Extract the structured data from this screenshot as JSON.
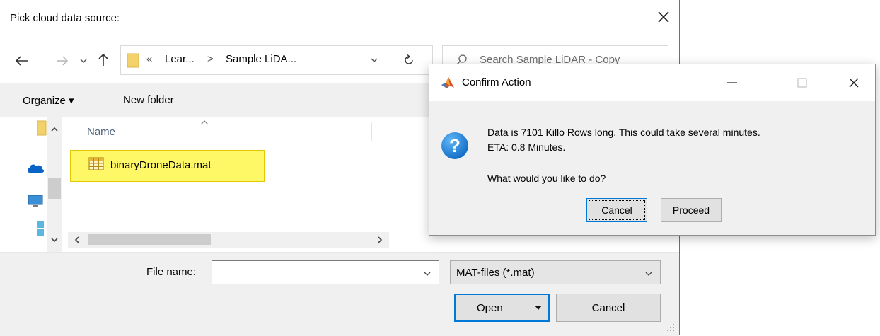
{
  "file_dialog": {
    "title": "Pick cloud data source:",
    "address": {
      "chevron_prefix": "«",
      "crumb1": "Lear...",
      "crumb_sep": ">",
      "crumb2": "Sample LiDA..."
    },
    "search": {
      "placeholder": "Search Sample LiDAR - Copy"
    },
    "toolbar": {
      "organize": "Organize ▾",
      "new_folder": "New folder"
    },
    "columns": {
      "name": "Name"
    },
    "files": [
      {
        "name": "binaryDroneData.mat",
        "icon": "table-file-icon"
      }
    ],
    "filename_label": "File name:",
    "filename_value": "",
    "filter_value": "MAT-files (*.mat)",
    "open_label": "Open",
    "cancel_label": "Cancel"
  },
  "confirm_dialog": {
    "title": "Confirm Action",
    "message_line1": "Data is 7101 Killo Rows long. This could take several minutes.",
    "message_line2": "ETA: 0.8 Minutes.",
    "question": "What would you like to do?",
    "cancel_label": "Cancel",
    "proceed_label": "Proceed"
  },
  "colors": {
    "selection_highlight": "#fff866",
    "question_icon": "#1b8ae6",
    "onedrive_icon": "#0a64c8",
    "button_border_focus": "#0078d7"
  }
}
